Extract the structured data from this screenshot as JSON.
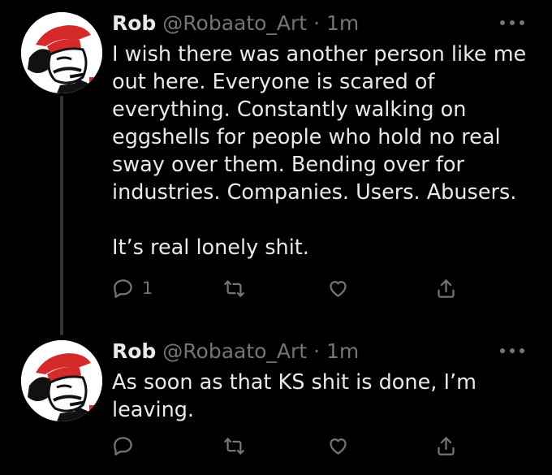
{
  "tweets": [
    {
      "name": "Rob",
      "handle": "@Robaato_Art",
      "separator": "·",
      "time": "1m",
      "text": "I wish there was another person like me out here. Everyone is scared of everything. Constantly walking on eggshells for people who hold no real sway over them. Bending over for industries. Companies. Users. Abusers.\n\nIt’s real lonely shit.",
      "reply_count": "1",
      "retweet_count": "",
      "like_count": ""
    },
    {
      "name": "Rob",
      "handle": "@Robaato_Art",
      "separator": "·",
      "time": "1m",
      "text": "As soon as that KS shit is done, I’m leaving.",
      "reply_count": "",
      "retweet_count": "",
      "like_count": ""
    }
  ],
  "colors": {
    "background": "#000000",
    "text": "#e7e9ea",
    "secondary": "#71767b",
    "thread_line": "#333639",
    "avatar_red": "#d42a2a"
  },
  "icons": [
    "avatar",
    "more-icon",
    "reply-icon",
    "retweet-icon",
    "like-icon",
    "share-icon"
  ]
}
